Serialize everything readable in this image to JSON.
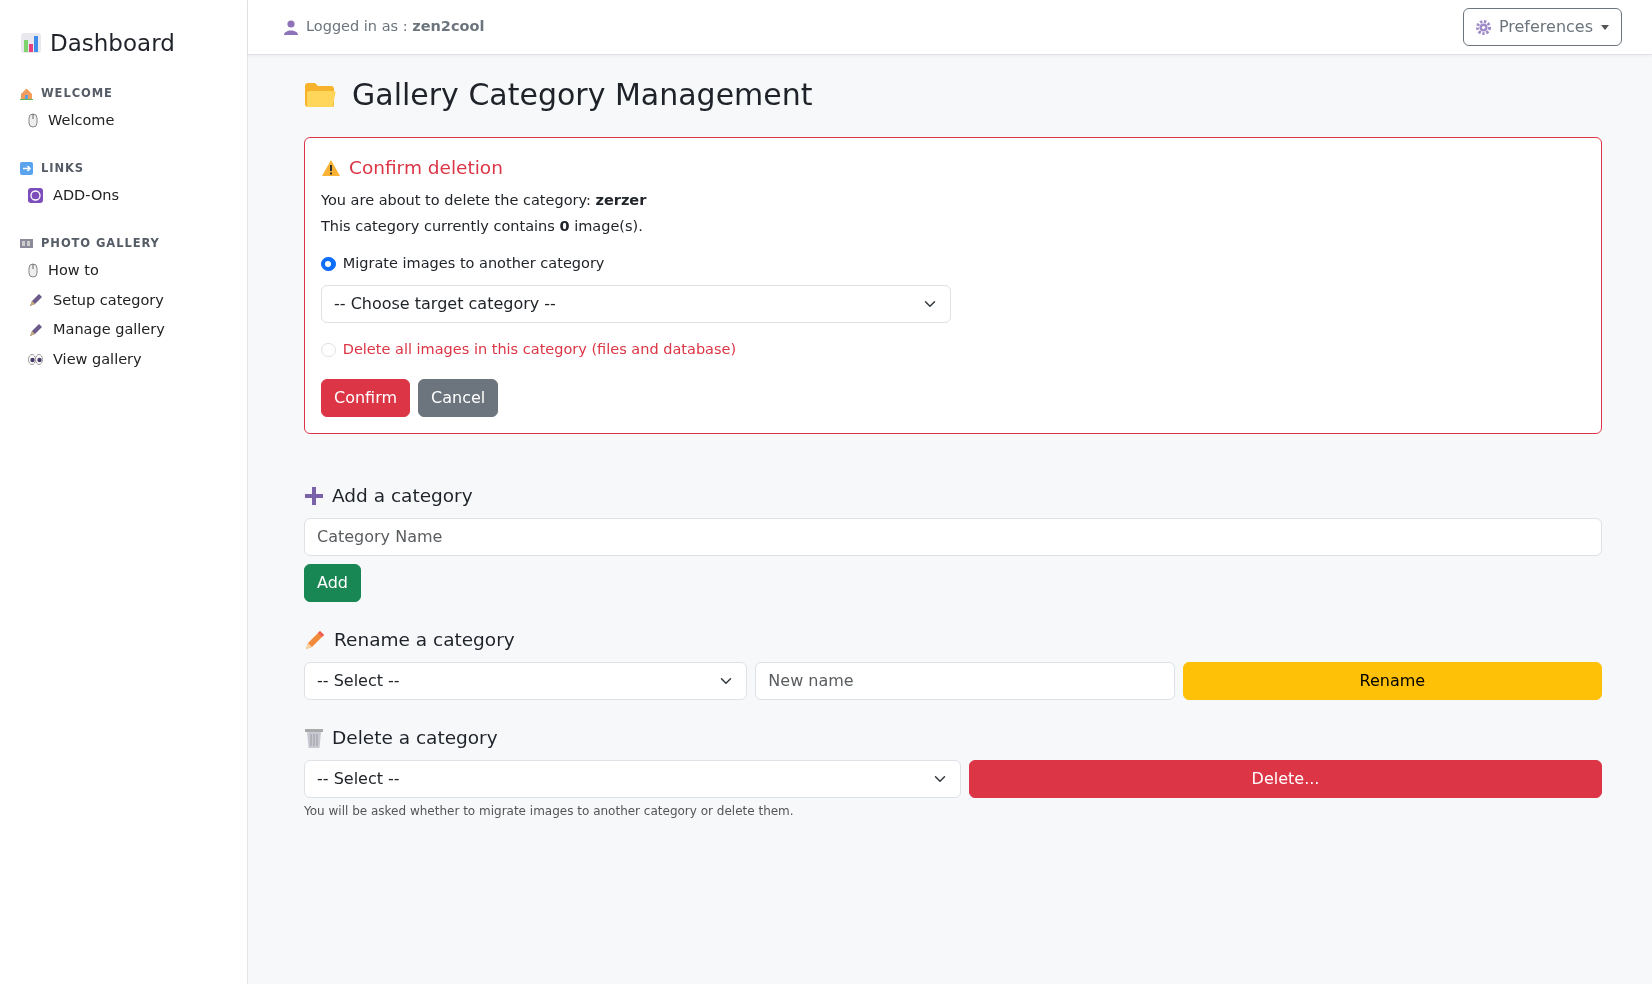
{
  "sidebar": {
    "brand": "Dashboard",
    "sections": [
      {
        "title": "WELCOME",
        "items": [
          {
            "label": "Welcome"
          }
        ]
      },
      {
        "title": "LINKS",
        "items": [
          {
            "label": "ADD-Ons"
          }
        ]
      },
      {
        "title": "PHOTO GALLERY",
        "items": [
          {
            "label": "How to"
          },
          {
            "label": "Setup category"
          },
          {
            "label": "Manage gallery"
          },
          {
            "label": "View gallery"
          }
        ]
      }
    ]
  },
  "topbar": {
    "user": "Logged in as : **zen2cool**",
    "preferences": "Preferences"
  },
  "page_title": "Gallery Category Management",
  "confirm_panel": {
    "title": "Confirm deletion",
    "lines": [
      "You are about to delete the category: **zerzer**",
      "This category currently contains **0** image(s)."
    ],
    "options": [
      {
        "label": "Migrate images to another category",
        "kind": "normal",
        "selected": true
      },
      {
        "label": "Delete all images in this category (files and database)",
        "kind": "danger",
        "selected": false
      }
    ],
    "target_select": "-- Choose target category --",
    "buttons": [
      {
        "label": "Confirm",
        "kind": "confirm"
      },
      {
        "label": "Cancel",
        "kind": "cancel"
      }
    ]
  },
  "add_section": {
    "title": "Add a category",
    "placeholder": "Category Name",
    "button": {
      "label": "Add",
      "kind": "add"
    }
  },
  "rename_section": {
    "title": "Rename a category",
    "select": "-- Select --",
    "placeholder": "New name",
    "button": {
      "label": "Rename",
      "kind": "rename"
    }
  },
  "delete_section": {
    "title": "Delete a category",
    "select": "-- Select --",
    "button": {
      "label": "Delete...",
      "kind": "delete"
    },
    "help": "You will be asked whether to migrate images to another category or delete them."
  }
}
